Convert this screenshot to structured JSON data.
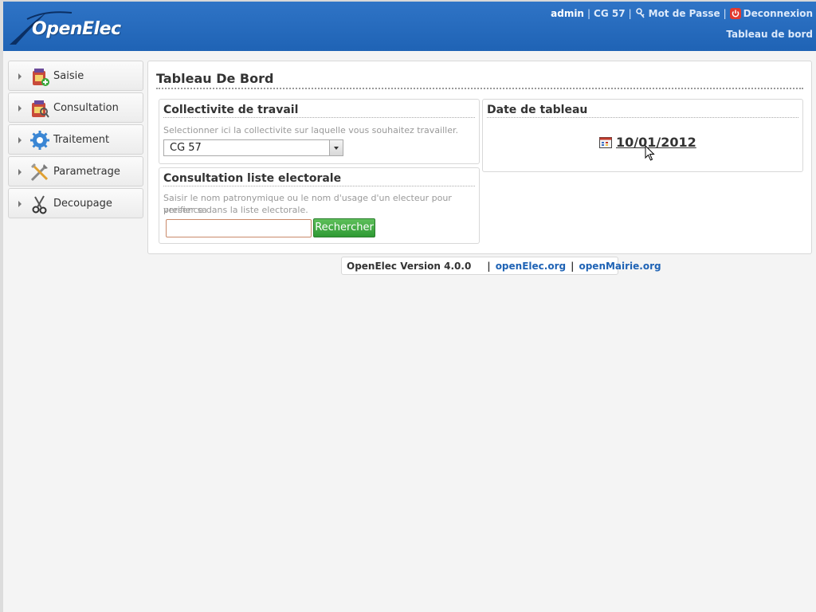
{
  "header": {
    "logo_text": "OpenElec",
    "user": "admin",
    "collectivite": "CG 57",
    "password_link": "Mot de Passe",
    "logout_link": "Deconnexion",
    "breadcrumb": "Tableau de bord",
    "separator": "|"
  },
  "sidebar": {
    "items": [
      {
        "label": "Saisie",
        "icon": "saisie-icon"
      },
      {
        "label": "Consultation",
        "icon": "consultation-icon"
      },
      {
        "label": "Traitement",
        "icon": "traitement-icon"
      },
      {
        "label": "Parametrage",
        "icon": "parametrage-icon"
      },
      {
        "label": "Decoupage",
        "icon": "decoupage-icon"
      }
    ]
  },
  "main": {
    "title": "Tableau De Bord",
    "collectivite_box": {
      "title": "Collectivite de travail",
      "hint": "Selectionner ici la collectivite sur laquelle vous souhaitez travailler.",
      "selected": "CG 57"
    },
    "consultation_box": {
      "title": "Consultation liste electorale",
      "hint_line1": "Saisir le nom patronymique ou le nom d'usage d'un electeur pour verifier sa",
      "hint_line2": "presence dans la liste electorale.",
      "input_value": "",
      "button_label": "Rechercher"
    },
    "date_box": {
      "title": "Date de tableau",
      "date": "10/01/2012"
    }
  },
  "footer": {
    "version": "OpenElec Version 4.0.0",
    "link1": "openElec.org",
    "link2": "openMairie.org",
    "separator": "|"
  },
  "colors": {
    "header_blue": "#1f63b5",
    "button_green": "#2f9a34",
    "link_blue": "#1f63b5"
  }
}
